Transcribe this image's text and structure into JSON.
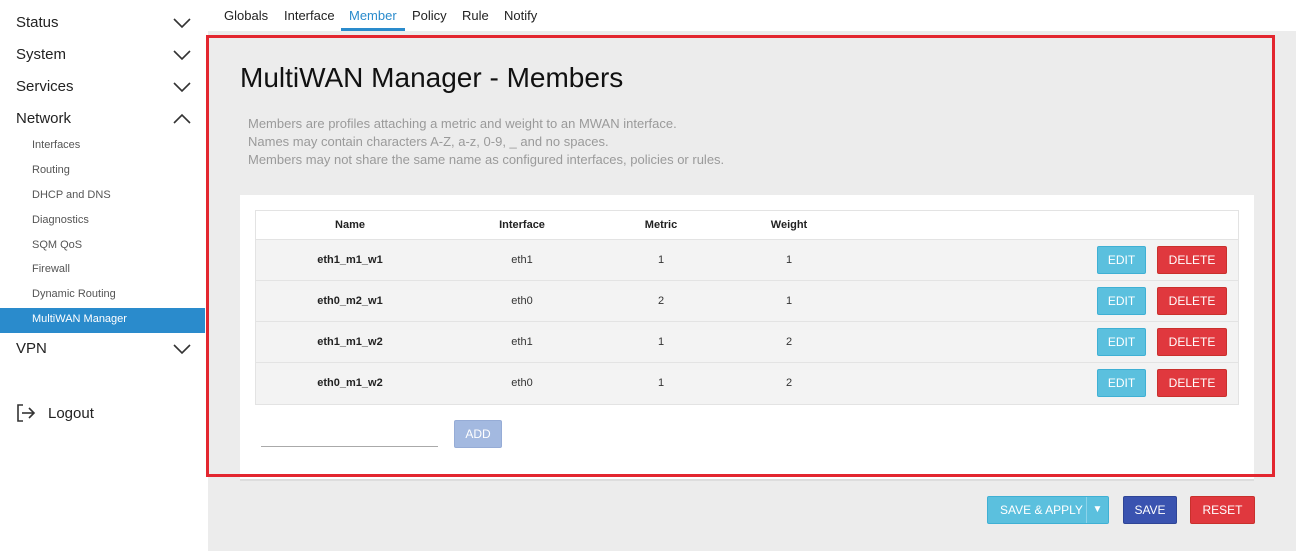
{
  "sidebar": {
    "menus": [
      {
        "label": "Status",
        "expanded": false,
        "icon": "chevron-down-icon"
      },
      {
        "label": "System",
        "expanded": false,
        "icon": "chevron-down-icon"
      },
      {
        "label": "Services",
        "expanded": false,
        "icon": "chevron-down-icon"
      },
      {
        "label": "Network",
        "expanded": true,
        "icon": "chevron-up-icon"
      },
      {
        "label": "VPN",
        "expanded": false,
        "icon": "chevron-down-icon"
      }
    ],
    "network_items": [
      {
        "label": "Interfaces"
      },
      {
        "label": "Routing"
      },
      {
        "label": "DHCP and DNS"
      },
      {
        "label": "Diagnostics"
      },
      {
        "label": "SQM QoS"
      },
      {
        "label": "Firewall"
      },
      {
        "label": "Dynamic Routing"
      },
      {
        "label": "MultiWAN Manager",
        "active": true
      }
    ],
    "logout": {
      "label": "Logout",
      "icon": "logout-icon"
    }
  },
  "tabs": [
    {
      "label": "Globals"
    },
    {
      "label": "Interface"
    },
    {
      "label": "Member",
      "active": true
    },
    {
      "label": "Policy"
    },
    {
      "label": "Rule"
    },
    {
      "label": "Notify"
    }
  ],
  "page": {
    "title": "MultiWAN Manager - Members",
    "description": [
      "Members are profiles attaching a metric and weight to an MWAN interface.",
      "Names may contain characters A-Z, a-z, 0-9, _ and no spaces.",
      "Members may not share the same name as configured interfaces, policies or rules."
    ]
  },
  "table": {
    "headers": [
      "Name",
      "Interface",
      "Metric",
      "Weight"
    ],
    "rows": [
      {
        "name": "eth1_m1_w1",
        "interface": "eth1",
        "metric": "1",
        "weight": "1"
      },
      {
        "name": "eth0_m2_w1",
        "interface": "eth0",
        "metric": "2",
        "weight": "1"
      },
      {
        "name": "eth1_m1_w2",
        "interface": "eth1",
        "metric": "1",
        "weight": "2"
      },
      {
        "name": "eth0_m1_w2",
        "interface": "eth0",
        "metric": "1",
        "weight": "2"
      }
    ],
    "edit_label": "EDIT",
    "delete_label": "DELETE"
  },
  "add": {
    "input_value": "",
    "button_label": "ADD"
  },
  "footer": {
    "save_apply_label": "SAVE & APPLY",
    "caret": "▼",
    "save_label": "SAVE",
    "reset_label": "RESET"
  },
  "colors": {
    "accent": "#2a8bcc",
    "info": "#5bc0de",
    "danger": "#e0383e",
    "primary": "#3a53b0",
    "highlight": "#e3262f"
  }
}
